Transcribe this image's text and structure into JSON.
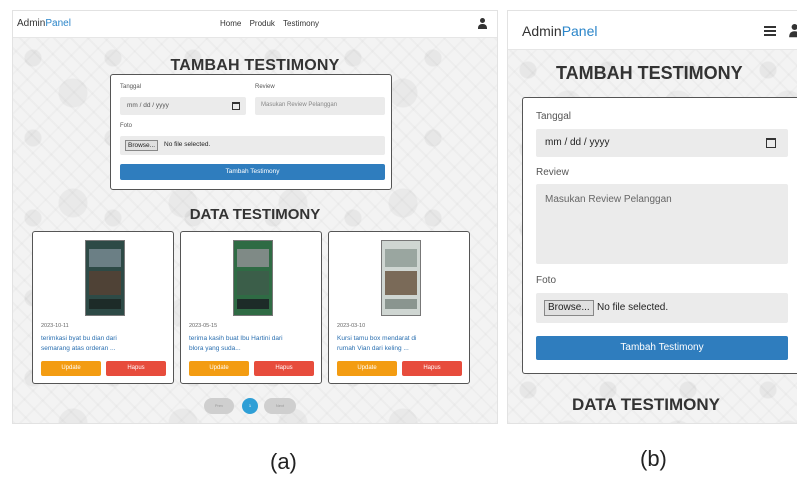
{
  "panel_a": {
    "brand_prefix": "Admin",
    "brand_accent": "Panel",
    "nav_links": [
      "Home",
      "Produk",
      "Testimony"
    ],
    "section_title": "TAMBAH TESTIMONY",
    "form": {
      "date_label": "Tanggal",
      "date_value": "mm / dd / yyyy",
      "review_label": "Review",
      "review_placeholder": "Masukan Review Pelanggan",
      "photo_label": "Foto",
      "browse_button": "Browse...",
      "file_status": "No file selected.",
      "submit_label": "Tambah Testimony"
    },
    "data_title": "DATA TESTIMONY",
    "cards": [
      {
        "date": "2023-10-11",
        "text_line1": "terimkasi byat bu dian dari",
        "text_line2": "semarang atas orderan ...",
        "update": "Update",
        "delete": "Hapus"
      },
      {
        "date": "2023-05-15",
        "text_line1": "terima kasih buat Ibu Hartini dari",
        "text_line2": "blora yang suda...",
        "update": "Update",
        "delete": "Hapus"
      },
      {
        "date": "2023-03-10",
        "text_line1": "Kursi tamu box mendarat di",
        "text_line2": "rumah Vian dari keling ...",
        "update": "Update",
        "delete": "Hapus"
      }
    ],
    "pagination": {
      "prev": "Prev",
      "current": "1",
      "next": "Next"
    }
  },
  "panel_b": {
    "brand_prefix": "Admin",
    "brand_accent": "Panel",
    "section_title": "TAMBAH TESTIMONY",
    "form": {
      "date_label": "Tanggal",
      "date_value": "mm / dd / yyyy",
      "review_label": "Review",
      "review_placeholder": "Masukan Review Pelanggan",
      "photo_label": "Foto",
      "browse_button": "Browse...",
      "file_status": "No file selected.",
      "submit_label": "Tambah Testimony"
    },
    "data_title": "DATA TESTIMONY"
  },
  "captions": {
    "a": "(a)",
    "b": "(b)"
  },
  "colors": {
    "accent": "#2a85c9",
    "submit": "#2f7dbe",
    "update": "#f39c12",
    "delete": "#e74c3c"
  },
  "icons": {
    "user": "user-icon",
    "menu": "hamburger-menu-icon",
    "calendar": "calendar-icon"
  }
}
